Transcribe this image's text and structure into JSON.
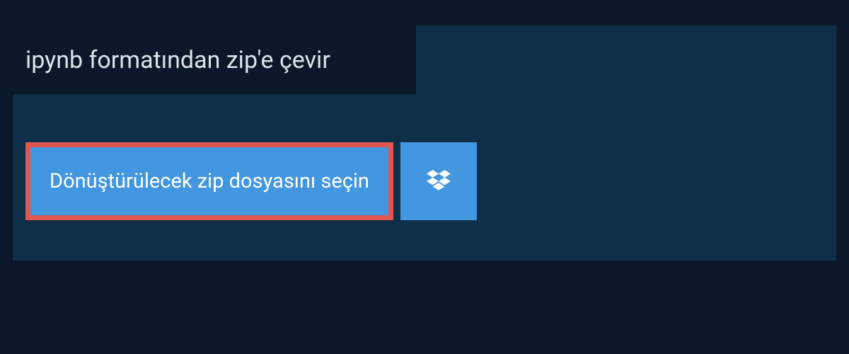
{
  "title": "ipynb formatından zip'e çevir",
  "select_button_label": "Dönüştürülecek zip dosyasını seçin"
}
